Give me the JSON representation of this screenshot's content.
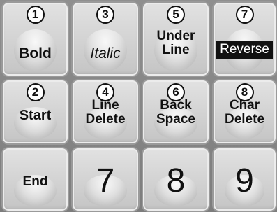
{
  "keys": [
    {
      "badge": "1",
      "label": "Bold"
    },
    {
      "badge": "3",
      "label": "Italic"
    },
    {
      "badge": "5",
      "line1": "Under",
      "line2": "Line"
    },
    {
      "badge": "7",
      "label": "Reverse"
    },
    {
      "badge": "2",
      "label": "Start"
    },
    {
      "badge": "4",
      "line1": "Line",
      "line2": "Delete"
    },
    {
      "badge": "6",
      "line1": "Back",
      "line2": "Space"
    },
    {
      "badge": "8",
      "line1": "Char",
      "line2": "Delete"
    },
    {
      "label": "End"
    },
    {
      "label": "7"
    },
    {
      "label": "8"
    },
    {
      "label": "9"
    }
  ],
  "colors": {
    "key_face": "#d6d6d6",
    "background": "#858585",
    "reverse_bar": "#111111",
    "text": "#111111"
  }
}
